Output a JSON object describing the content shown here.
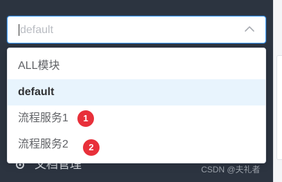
{
  "select": {
    "placeholder": "default",
    "arrow_icon": "chevron-up-icon"
  },
  "dropdown": {
    "options": [
      {
        "label": "ALL模块",
        "selected": false,
        "badge": ""
      },
      {
        "label": "default",
        "selected": true,
        "badge": ""
      },
      {
        "label": "流程服务1",
        "selected": false,
        "badge": "1"
      },
      {
        "label": "流程服务2",
        "selected": false,
        "badge": "2"
      }
    ]
  },
  "behind_menu": {
    "label_partial": "文档管理",
    "icon": "gear-icon"
  },
  "watermark": "CSDN @夫礼者",
  "colors": {
    "sidebar_bg": "#2c3440",
    "accent": "#409eff",
    "selected_bg": "#e8f4fd",
    "badge": "#e8303a"
  }
}
